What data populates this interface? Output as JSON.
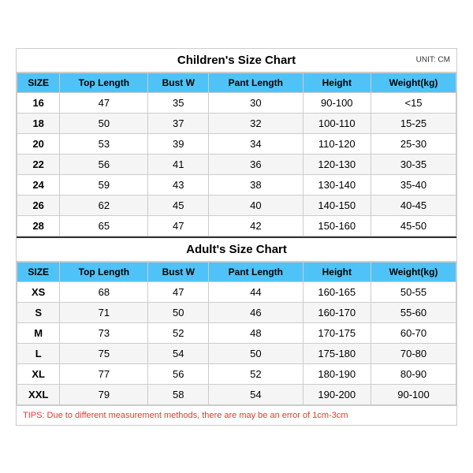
{
  "children_chart": {
    "title": "Children's Size Chart",
    "unit": "UNIT: CM",
    "headers": [
      "SIZE",
      "Top Length",
      "Bust W",
      "Pant Length",
      "Height",
      "Weight(kg)"
    ],
    "rows": [
      [
        "16",
        "47",
        "35",
        "30",
        "90-100",
        "<15"
      ],
      [
        "18",
        "50",
        "37",
        "32",
        "100-110",
        "15-25"
      ],
      [
        "20",
        "53",
        "39",
        "34",
        "110-120",
        "25-30"
      ],
      [
        "22",
        "56",
        "41",
        "36",
        "120-130",
        "30-35"
      ],
      [
        "24",
        "59",
        "43",
        "38",
        "130-140",
        "35-40"
      ],
      [
        "26",
        "62",
        "45",
        "40",
        "140-150",
        "40-45"
      ],
      [
        "28",
        "65",
        "47",
        "42",
        "150-160",
        "45-50"
      ]
    ]
  },
  "adult_chart": {
    "title": "Adult's Size Chart",
    "headers": [
      "SIZE",
      "Top Length",
      "Bust W",
      "Pant Length",
      "Height",
      "Weight(kg)"
    ],
    "rows": [
      [
        "XS",
        "68",
        "47",
        "44",
        "160-165",
        "50-55"
      ],
      [
        "S",
        "71",
        "50",
        "46",
        "160-170",
        "55-60"
      ],
      [
        "M",
        "73",
        "52",
        "48",
        "170-175",
        "60-70"
      ],
      [
        "L",
        "75",
        "54",
        "50",
        "175-180",
        "70-80"
      ],
      [
        "XL",
        "77",
        "56",
        "52",
        "180-190",
        "80-90"
      ],
      [
        "XXL",
        "79",
        "58",
        "54",
        "190-200",
        "90-100"
      ]
    ]
  },
  "tips": "TIPS: Due to different measurement methods, there are may be an error of 1cm-3cm"
}
